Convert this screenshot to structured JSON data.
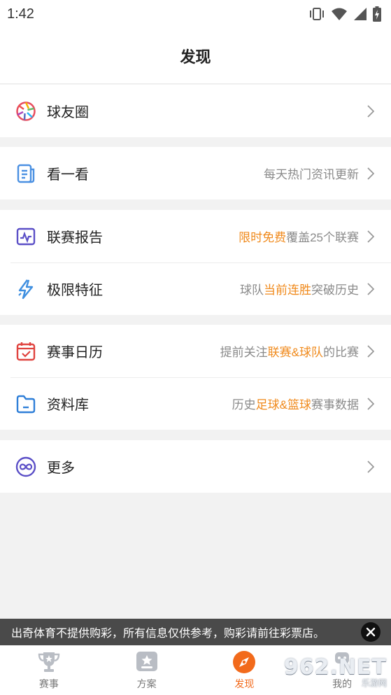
{
  "status_bar": {
    "time": "1:42"
  },
  "header": {
    "title": "发现"
  },
  "groups": [
    {
      "items": [
        {
          "label": "球友圈",
          "icon": "aperture-icon"
        }
      ]
    },
    {
      "items": [
        {
          "label": "看一看",
          "icon": "document-icon",
          "desc": "每天热门资讯更新"
        }
      ]
    },
    {
      "items": [
        {
          "label": "联赛报告",
          "icon": "pulse-chart-icon",
          "desc_highlight": "限时免费",
          "desc_rest": "覆盖25个联赛"
        },
        {
          "label": "极限特征",
          "icon": "lightning-icon",
          "desc_pre": "球队",
          "desc_highlight": "当前连胜",
          "desc_post": "突破历史"
        }
      ]
    },
    {
      "items": [
        {
          "label": "赛事日历",
          "icon": "calendar-icon",
          "desc_pre": "提前关注",
          "desc_highlight": "联赛&球队",
          "desc_post": "的比赛"
        },
        {
          "label": "资料库",
          "icon": "folder-icon",
          "desc_pre": "历史",
          "desc_highlight": "足球&篮球",
          "desc_post": "赛事数据"
        }
      ]
    },
    {
      "items": [
        {
          "label": "更多",
          "icon": "infinity-icon"
        }
      ]
    }
  ],
  "notice": {
    "text": "出奇体育不提供购彩，所有信息仅供参考，购彩请前往彩票店。"
  },
  "tabs": [
    {
      "label": "赛事",
      "icon": "trophy-icon"
    },
    {
      "label": "方案",
      "icon": "star-card-icon"
    },
    {
      "label": "发现",
      "icon": "compass-icon",
      "active": true
    },
    {
      "label": "我的",
      "icon": "profile-icon"
    }
  ],
  "watermark": {
    "main": "962.NET",
    "sub": "乐游网"
  },
  "colors": {
    "accent": "#f26a1b",
    "highlight": "#f08a1c",
    "notice_bg": "#4a4a4a"
  }
}
